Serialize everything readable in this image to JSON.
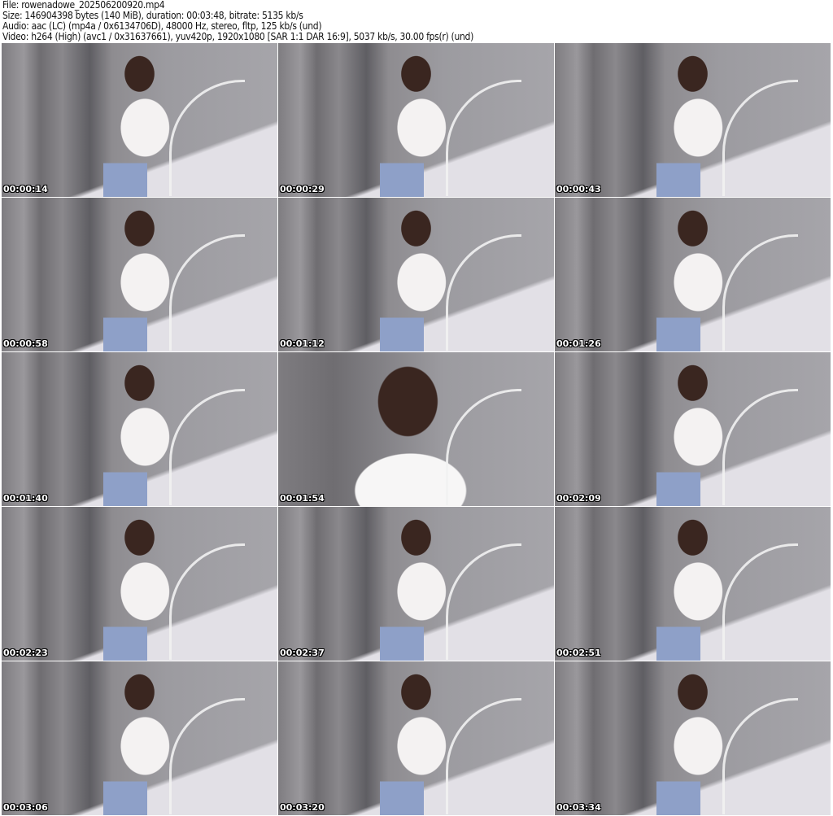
{
  "header": {
    "file": "File: rowenadowe_202506200920.mp4",
    "size": "Size: 146904398 bytes (140 MiB), duration: 00:03:48, bitrate: 5135 kb/s",
    "audio": "Audio: aac (LC) (mp4a / 0x6134706D), 48000 Hz, stereo, fltp, 125 kb/s (und)",
    "video": "Video: h264 (High) (avc1 / 0x31637661), yuv420p, 1920x1080 [SAR 1:1 DAR 16:9], 5037 kb/s, 30.00 fps(r) (und)"
  },
  "frames": [
    "00:00:14",
    "00:00:29",
    "00:00:43",
    "00:00:58",
    "00:01:12",
    "00:01:26",
    "00:01:40",
    "00:01:54",
    "00:02:09",
    "00:02:23",
    "00:02:37",
    "00:02:51",
    "00:03:06",
    "00:03:20",
    "00:03:34"
  ]
}
